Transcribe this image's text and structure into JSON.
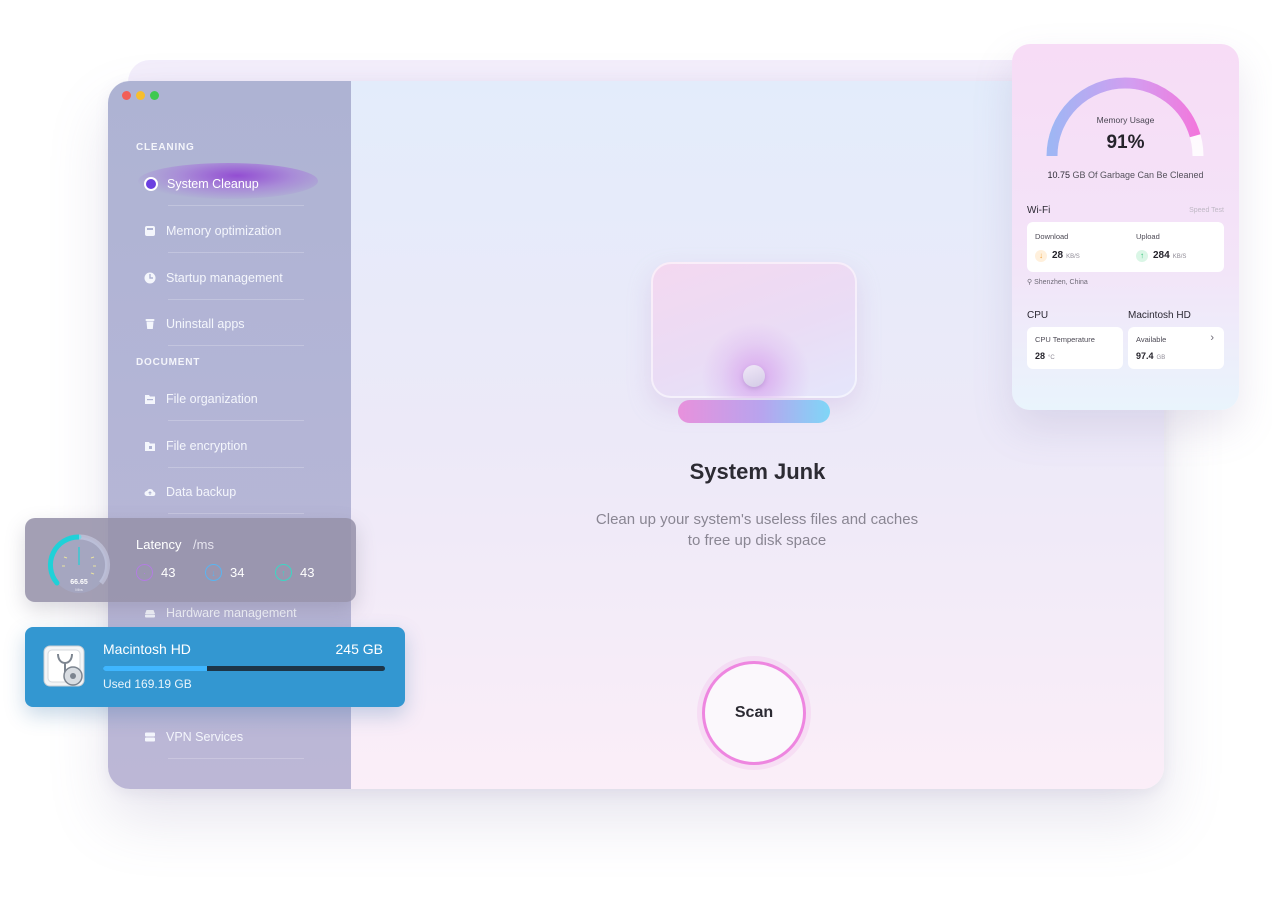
{
  "window": {
    "sidebar": {
      "sections": [
        {
          "label": "CLEANING",
          "items": [
            {
              "label": "System Cleanup",
              "icon": "system-cleanup-icon",
              "active": true
            },
            {
              "label": "Memory optimization",
              "icon": "memory-icon"
            },
            {
              "label": "Startup management",
              "icon": "startup-icon"
            },
            {
              "label": "Uninstall apps",
              "icon": "trash-icon"
            }
          ]
        },
        {
          "label": "DOCUMENT",
          "items": [
            {
              "label": "File organization",
              "icon": "folder-icon"
            },
            {
              "label": "File encryption",
              "icon": "lock-folder-icon"
            },
            {
              "label": "Data backup",
              "icon": "cloud-upload-icon"
            },
            {
              "label": "Hardware management",
              "icon": "hardware-icon"
            },
            {
              "label": "VPN Services",
              "icon": "server-icon"
            }
          ]
        }
      ]
    },
    "main": {
      "title": "System Junk",
      "description_line1": "Clean up your system's useless files and caches",
      "description_line2": "to free up disk space",
      "scan_label": "Scan"
    }
  },
  "panel": {
    "memory_label": "Memory Usage",
    "memory_percent": "91%",
    "memory_fraction": 0.91,
    "garbage_value": "10.75",
    "garbage_text": "GB Of Garbage Can Be Cleaned",
    "wifi": {
      "title": "Wi-Fi",
      "speed_test": "Speed Test",
      "download_label": "Download",
      "download_value": "28",
      "download_unit": "KB/S",
      "upload_label": "Upload",
      "upload_value": "284",
      "upload_unit": "KB/S",
      "location": "Shenzhen, China"
    },
    "cpu": {
      "title": "CPU",
      "label": "CPU Temperature",
      "value": "28",
      "unit": "°C"
    },
    "disk": {
      "title": "Macintosh HD",
      "label": "Available",
      "value": "97.4",
      "unit": "GB"
    }
  },
  "latency": {
    "title": "Latency",
    "unit": "/ms",
    "gauge_value": "66.65",
    "gauge_unit": "Mbs",
    "ping": "43",
    "download": "34",
    "upload": "43"
  },
  "disk_widget": {
    "name": "Macintosh HD",
    "size": "245 GB",
    "used": "Used 169.19 GB",
    "used_fraction": 0.37
  },
  "colors": {
    "accent_pink": "#ee86e0",
    "disk_blue": "#3397d1",
    "gauge_cyan": "#1fd1d8"
  }
}
